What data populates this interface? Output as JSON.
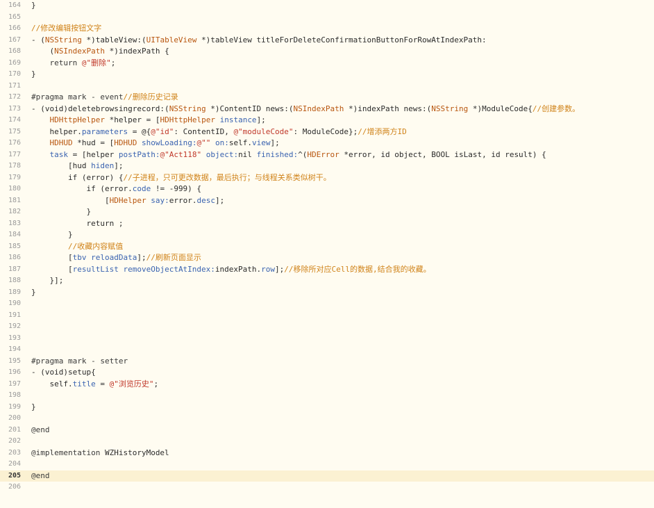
{
  "editor": {
    "current_line": 205,
    "lines": [
      {
        "n": 164,
        "tokens": [
          {
            "t": "}",
            "c": "plain"
          }
        ]
      },
      {
        "n": 165,
        "tokens": []
      },
      {
        "n": 166,
        "tokens": [
          {
            "t": "//修改编辑按钮文字",
            "c": "comment"
          }
        ]
      },
      {
        "n": 167,
        "tokens": [
          {
            "t": "- (",
            "c": "plain"
          },
          {
            "t": "NSString",
            "c": "type"
          },
          {
            "t": " *)tableView:(",
            "c": "plain"
          },
          {
            "t": "UITableView",
            "c": "type"
          },
          {
            "t": " *)tableView titleForDeleteConfirmationButtonForRowAtIndexPath:",
            "c": "plain"
          }
        ]
      },
      {
        "n": 168,
        "tokens": [
          {
            "t": "    (",
            "c": "plain"
          },
          {
            "t": "NSIndexPath",
            "c": "type"
          },
          {
            "t": " *)indexPath {",
            "c": "plain"
          }
        ]
      },
      {
        "n": 169,
        "tokens": [
          {
            "t": "    return ",
            "c": "kw"
          },
          {
            "t": "@\"删除\"",
            "c": "string"
          },
          {
            "t": ";",
            "c": "plain"
          }
        ]
      },
      {
        "n": 170,
        "tokens": [
          {
            "t": "}",
            "c": "plain"
          }
        ]
      },
      {
        "n": 171,
        "tokens": []
      },
      {
        "n": 172,
        "tokens": [
          {
            "t": "#pragma mark - event",
            "c": "pp"
          },
          {
            "t": "//删除历史记录",
            "c": "comment"
          }
        ]
      },
      {
        "n": 173,
        "tokens": [
          {
            "t": "- (void)deletebrowsingrecord:(",
            "c": "plain"
          },
          {
            "t": "NSString",
            "c": "type"
          },
          {
            "t": " *)ContentID news:(",
            "c": "plain"
          },
          {
            "t": "NSIndexPath",
            "c": "type"
          },
          {
            "t": " *)indexPath news:(",
            "c": "plain"
          },
          {
            "t": "NSString",
            "c": "type"
          },
          {
            "t": " *)ModuleCode{",
            "c": "plain"
          },
          {
            "t": "//创建参数。",
            "c": "comment"
          }
        ]
      },
      {
        "n": 174,
        "tokens": [
          {
            "t": "    ",
            "c": "plain"
          },
          {
            "t": "HDHttpHelper",
            "c": "type"
          },
          {
            "t": " *helper = [",
            "c": "plain"
          },
          {
            "t": "HDHttpHelper",
            "c": "type"
          },
          {
            "t": " ",
            "c": "plain"
          },
          {
            "t": "instance",
            "c": "method"
          },
          {
            "t": "];",
            "c": "plain"
          }
        ]
      },
      {
        "n": 175,
        "tokens": [
          {
            "t": "    helper.",
            "c": "plain"
          },
          {
            "t": "parameters",
            "c": "method"
          },
          {
            "t": " = @{",
            "c": "plain"
          },
          {
            "t": "@\"id\"",
            "c": "string"
          },
          {
            "t": ": ContentID, ",
            "c": "plain"
          },
          {
            "t": "@\"moduleCode\"",
            "c": "string"
          },
          {
            "t": ": ModuleCode};",
            "c": "plain"
          },
          {
            "t": "//增添两方ID",
            "c": "comment"
          }
        ]
      },
      {
        "n": 176,
        "tokens": [
          {
            "t": "    ",
            "c": "plain"
          },
          {
            "t": "HDHUD",
            "c": "type"
          },
          {
            "t": " *hud = [",
            "c": "plain"
          },
          {
            "t": "HDHUD",
            "c": "type"
          },
          {
            "t": " ",
            "c": "plain"
          },
          {
            "t": "showLoading:",
            "c": "method"
          },
          {
            "t": "@\"\"",
            "c": "string"
          },
          {
            "t": " ",
            "c": "plain"
          },
          {
            "t": "on:",
            "c": "method"
          },
          {
            "t": "self.",
            "c": "plain"
          },
          {
            "t": "view",
            "c": "method"
          },
          {
            "t": "];",
            "c": "plain"
          }
        ]
      },
      {
        "n": 177,
        "tokens": [
          {
            "t": "    ",
            "c": "plain"
          },
          {
            "t": "task",
            "c": "method"
          },
          {
            "t": " = [helper ",
            "c": "plain"
          },
          {
            "t": "postPath:",
            "c": "method"
          },
          {
            "t": "@\"Act118\"",
            "c": "string"
          },
          {
            "t": " ",
            "c": "plain"
          },
          {
            "t": "object:",
            "c": "method"
          },
          {
            "t": "nil ",
            "c": "plain"
          },
          {
            "t": "finished:",
            "c": "method"
          },
          {
            "t": "^(",
            "c": "plain"
          },
          {
            "t": "HDError",
            "c": "type"
          },
          {
            "t": " *error, id object, BOOL isLast, id result) {",
            "c": "plain"
          }
        ]
      },
      {
        "n": 178,
        "tokens": [
          {
            "t": "        [hud ",
            "c": "plain"
          },
          {
            "t": "hiden",
            "c": "method"
          },
          {
            "t": "];",
            "c": "plain"
          }
        ]
      },
      {
        "n": 179,
        "tokens": [
          {
            "t": "        if (error) {",
            "c": "plain"
          },
          {
            "t": "//子进程，只可更改数据，最后执行；与线程关系类似树干。",
            "c": "comment"
          }
        ]
      },
      {
        "n": 180,
        "tokens": [
          {
            "t": "            if (error.",
            "c": "plain"
          },
          {
            "t": "code",
            "c": "method"
          },
          {
            "t": " != -999) {",
            "c": "plain"
          }
        ]
      },
      {
        "n": 181,
        "tokens": [
          {
            "t": "                [",
            "c": "plain"
          },
          {
            "t": "HDHelper",
            "c": "type"
          },
          {
            "t": " ",
            "c": "plain"
          },
          {
            "t": "say:",
            "c": "method"
          },
          {
            "t": "error.",
            "c": "plain"
          },
          {
            "t": "desc",
            "c": "method"
          },
          {
            "t": "];",
            "c": "plain"
          }
        ]
      },
      {
        "n": 182,
        "tokens": [
          {
            "t": "            }",
            "c": "plain"
          }
        ]
      },
      {
        "n": 183,
        "tokens": [
          {
            "t": "            return ;",
            "c": "plain"
          }
        ]
      },
      {
        "n": 184,
        "tokens": [
          {
            "t": "        }",
            "c": "plain"
          }
        ]
      },
      {
        "n": 185,
        "tokens": [
          {
            "t": "        //收藏内容赋值",
            "c": "comment"
          }
        ]
      },
      {
        "n": 186,
        "tokens": [
          {
            "t": "        [",
            "c": "plain"
          },
          {
            "t": "tbv",
            "c": "method"
          },
          {
            "t": " ",
            "c": "plain"
          },
          {
            "t": "reloadData",
            "c": "method"
          },
          {
            "t": "];",
            "c": "plain"
          },
          {
            "t": "//刷新页面显示",
            "c": "comment"
          }
        ]
      },
      {
        "n": 187,
        "tokens": [
          {
            "t": "        [",
            "c": "plain"
          },
          {
            "t": "resultList",
            "c": "method"
          },
          {
            "t": " ",
            "c": "plain"
          },
          {
            "t": "removeObjectAtIndex:",
            "c": "method"
          },
          {
            "t": "indexPath.",
            "c": "plain"
          },
          {
            "t": "row",
            "c": "method"
          },
          {
            "t": "];",
            "c": "plain"
          },
          {
            "t": "//移除所对应Cell的数据,结合我的收藏。",
            "c": "comment"
          }
        ]
      },
      {
        "n": 188,
        "tokens": [
          {
            "t": "    }];",
            "c": "plain"
          }
        ]
      },
      {
        "n": 189,
        "tokens": [
          {
            "t": "}",
            "c": "plain"
          }
        ]
      },
      {
        "n": 190,
        "tokens": []
      },
      {
        "n": 191,
        "tokens": []
      },
      {
        "n": 192,
        "tokens": []
      },
      {
        "n": 193,
        "tokens": []
      },
      {
        "n": 194,
        "tokens": []
      },
      {
        "n": 195,
        "tokens": [
          {
            "t": "#pragma mark - setter",
            "c": "pp"
          }
        ]
      },
      {
        "n": 196,
        "tokens": [
          {
            "t": "- (void)setup{",
            "c": "plain"
          }
        ]
      },
      {
        "n": 197,
        "tokens": [
          {
            "t": "    self.",
            "c": "plain"
          },
          {
            "t": "title",
            "c": "method"
          },
          {
            "t": " = ",
            "c": "plain"
          },
          {
            "t": "@\"浏览历史\"",
            "c": "string"
          },
          {
            "t": ";",
            "c": "plain"
          }
        ]
      },
      {
        "n": 198,
        "tokens": []
      },
      {
        "n": 199,
        "tokens": [
          {
            "t": "}",
            "c": "plain"
          }
        ]
      },
      {
        "n": 200,
        "tokens": []
      },
      {
        "n": 201,
        "tokens": [
          {
            "t": "@end",
            "c": "kw"
          }
        ]
      },
      {
        "n": 202,
        "tokens": []
      },
      {
        "n": 203,
        "tokens": [
          {
            "t": "@implementation",
            "c": "kw"
          },
          {
            "t": " WZHistoryModel",
            "c": "plain"
          }
        ]
      },
      {
        "n": 204,
        "tokens": []
      },
      {
        "n": 205,
        "tokens": [
          {
            "t": "@end",
            "c": "kw"
          }
        ]
      },
      {
        "n": 206,
        "tokens": []
      }
    ]
  }
}
